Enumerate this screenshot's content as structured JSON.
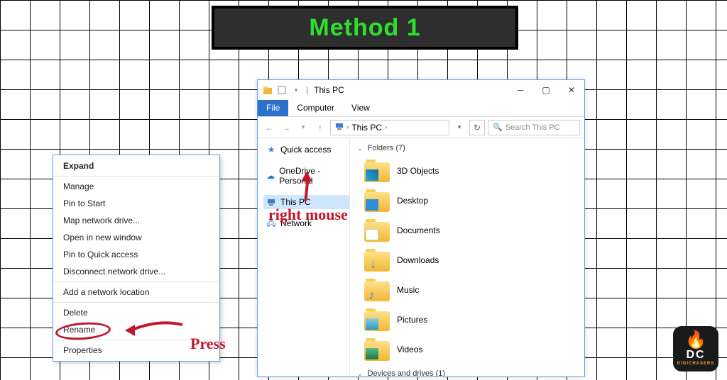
{
  "banner": {
    "title": "Method 1"
  },
  "explorer": {
    "title": "This PC",
    "ribbon": {
      "file": "File",
      "tabs": [
        "Computer",
        "View"
      ]
    },
    "address": {
      "path": "This PC",
      "chevron": "›"
    },
    "search": {
      "placeholder": "Search This PC"
    },
    "nav": {
      "quick_access": "Quick access",
      "onedrive": "OneDrive - Personal",
      "this_pc": "This PC",
      "network": "Network"
    },
    "sections": {
      "folders_header": "Folders (7)",
      "devices_header": "Devices and drives (1)"
    },
    "folders": [
      "3D Objects",
      "Desktop",
      "Documents",
      "Downloads",
      "Music",
      "Pictures",
      "Videos"
    ]
  },
  "context_menu": {
    "groups": [
      [
        "Expand"
      ],
      [
        "Manage",
        "Pin to Start",
        "Map network drive...",
        "Open in new window",
        "Pin to Quick access",
        "Disconnect network drive..."
      ],
      [
        "Add a network location"
      ],
      [
        "Delete",
        "Rename"
      ],
      [
        "Properties"
      ]
    ]
  },
  "annotations": {
    "right_mouse": "right mouse",
    "press": "Press"
  },
  "logo": {
    "dc": "DC",
    "sub": "DIGICHASERS"
  }
}
